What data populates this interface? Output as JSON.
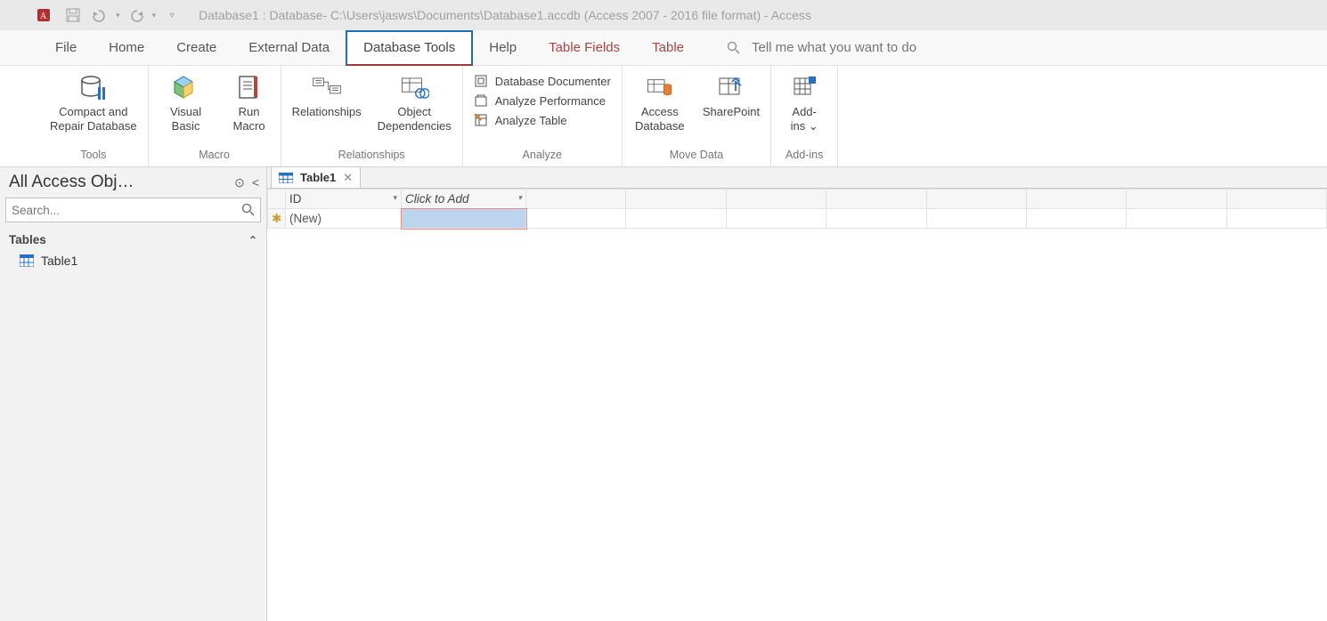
{
  "title": "Database1 : Database- C:\\Users\\jasws\\Documents\\Database1.accdb (Access 2007 - 2016 file format)  -  Access",
  "tabs": {
    "file": "File",
    "home": "Home",
    "create": "Create",
    "external": "External Data",
    "dbtools": "Database Tools",
    "help": "Help",
    "tablefields": "Table Fields",
    "table": "Table"
  },
  "tellme": {
    "placeholder": "Tell me what you want to do"
  },
  "ribbon": {
    "compact": "Compact and\nRepair Database",
    "visualbasic": "Visual\nBasic",
    "runmacro": "Run\nMacro",
    "relationships": "Relationships",
    "objdep": "Object\nDependencies",
    "dbdoc": "Database Documenter",
    "analyzeperf": "Analyze Performance",
    "analyzetable": "Analyze Table",
    "accessdb": "Access\nDatabase",
    "sharepoint": "SharePoint",
    "addins": "Add-\nins ⌄",
    "group_tools": "Tools",
    "group_macro": "Macro",
    "group_rel": "Relationships",
    "group_analyze": "Analyze",
    "group_move": "Move Data",
    "group_addins": "Add-ins"
  },
  "nav": {
    "header": "All Access Obj…",
    "search_placeholder": "Search...",
    "cat_tables": "Tables",
    "item_table1": "Table1"
  },
  "doc": {
    "tab_table1": "Table1",
    "col_id": "ID",
    "col_add": "Click to Add",
    "row_new": "(New)"
  }
}
